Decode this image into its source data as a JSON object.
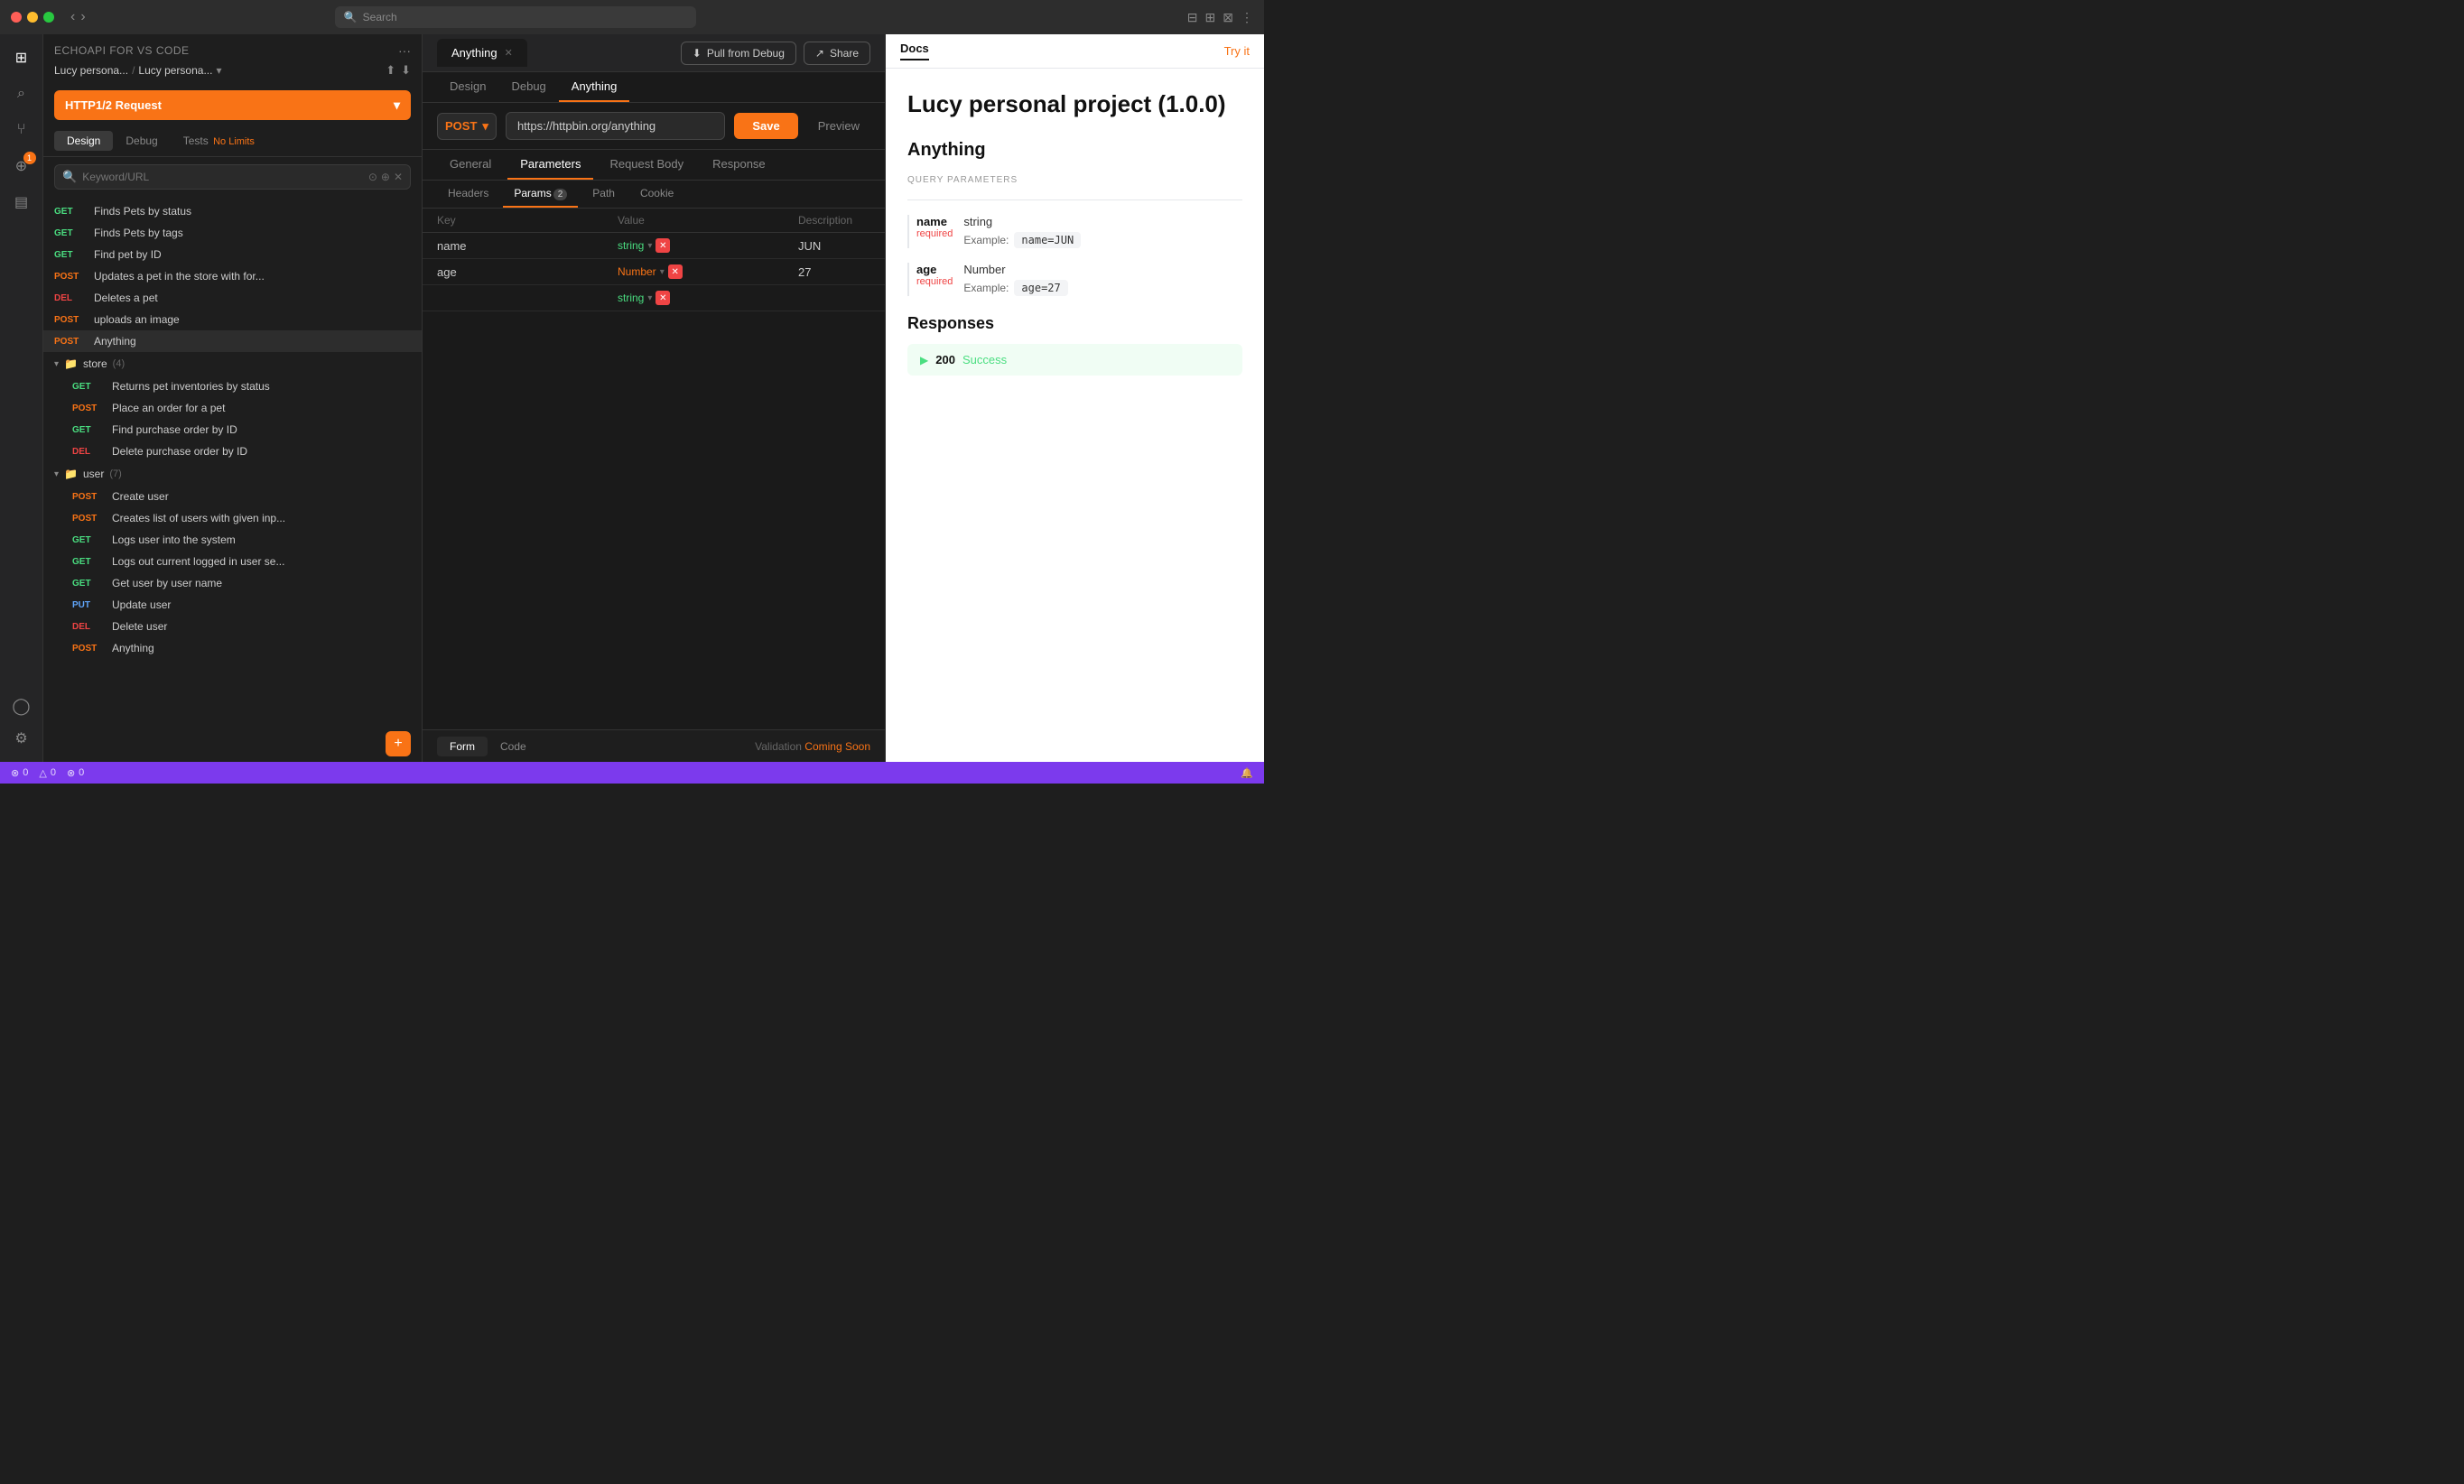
{
  "titlebar": {
    "search_placeholder": "Search",
    "icons": [
      "sidebar-icon",
      "layout-icon",
      "split-icon",
      "grid-icon"
    ]
  },
  "icon_sidebar": {
    "items": [
      {
        "name": "layers-icon",
        "symbol": "⊞",
        "active": true
      },
      {
        "name": "search-icon",
        "symbol": "⌕"
      },
      {
        "name": "git-icon",
        "symbol": "⑂"
      },
      {
        "name": "extension-icon",
        "symbol": "⊕",
        "badge": "1"
      },
      {
        "name": "collection-icon",
        "symbol": "▤"
      },
      {
        "name": "user-icon",
        "symbol": "○"
      },
      {
        "name": "settings-icon",
        "symbol": "⚙"
      }
    ]
  },
  "tree_panel": {
    "title": "ECHOAPI FOR VS CODE",
    "breadcrumb1": "Lucy persona...",
    "breadcrumb2": "Lucy persona...",
    "request_btn_label": "HTTP1/2 Request",
    "design_tab": "Design",
    "debug_tab": "Debug",
    "tests_tab": "Tests",
    "no_limits": "No Limits",
    "search_placeholder": "Keyword/URL",
    "tree_items": [
      {
        "type": "item",
        "method": "GET",
        "label": "Finds Pets by status",
        "method_class": "method-get"
      },
      {
        "type": "item",
        "method": "GET",
        "label": "Finds Pets by tags",
        "method_class": "method-get"
      },
      {
        "type": "item",
        "method": "GET",
        "label": "Find pet by ID",
        "method_class": "method-get"
      },
      {
        "type": "item",
        "method": "POST",
        "label": "Updates a pet in the store with for...",
        "method_class": "method-post"
      },
      {
        "type": "item",
        "method": "DEL",
        "label": "Deletes a pet",
        "method_class": "method-del"
      },
      {
        "type": "item",
        "method": "POST",
        "label": "uploads an image",
        "method_class": "method-post"
      },
      {
        "type": "item",
        "method": "POST",
        "label": "Anything",
        "method_class": "method-post",
        "active": true
      },
      {
        "type": "group",
        "icon": "folder",
        "label": "store",
        "count": "(4)"
      },
      {
        "type": "item",
        "method": "GET",
        "label": "Returns pet inventories by status",
        "method_class": "method-get",
        "indent": true
      },
      {
        "type": "item",
        "method": "POST",
        "label": "Place an order for a pet",
        "method_class": "method-post",
        "indent": true
      },
      {
        "type": "item",
        "method": "GET",
        "label": "Find purchase order by ID",
        "method_class": "method-get",
        "indent": true
      },
      {
        "type": "item",
        "method": "DEL",
        "label": "Delete purchase order by ID",
        "method_class": "method-del",
        "indent": true
      },
      {
        "type": "group",
        "icon": "folder",
        "label": "user",
        "count": "(7)"
      },
      {
        "type": "item",
        "method": "POST",
        "label": "Create user",
        "method_class": "method-post",
        "indent": true
      },
      {
        "type": "item",
        "method": "POST",
        "label": "Creates list of users with given inp...",
        "method_class": "method-post",
        "indent": true
      },
      {
        "type": "item",
        "method": "GET",
        "label": "Logs user into the system",
        "method_class": "method-get",
        "indent": true
      },
      {
        "type": "item",
        "method": "GET",
        "label": "Logs out current logged in user se...",
        "method_class": "method-get",
        "indent": true
      },
      {
        "type": "item",
        "method": "GET",
        "label": "Get user by user name",
        "method_class": "method-get",
        "indent": true
      },
      {
        "type": "item",
        "method": "PUT",
        "label": "Update user",
        "method_class": "method-put",
        "indent": true
      },
      {
        "type": "item",
        "method": "DEL",
        "label": "Delete user",
        "method_class": "method-del",
        "indent": true
      },
      {
        "type": "item",
        "method": "POST",
        "label": "Anything",
        "method_class": "method-post",
        "indent": true
      }
    ]
  },
  "main": {
    "tab_label": "Anything",
    "design_tab": "Design",
    "debug_tab": "Debug",
    "anything_tab": "Anything",
    "pull_debug_btn": "Pull from Debug",
    "share_btn": "Share",
    "method": "POST",
    "url": "https://httpbin.org/anything",
    "save_btn": "Save",
    "preview_btn": "Preview",
    "req_tabs": [
      "General",
      "Parameters",
      "Request Body",
      "Response"
    ],
    "params_sub_tabs": [
      "Headers",
      "Params",
      "Path",
      "Cookie"
    ],
    "params_badge": "2",
    "params_table": {
      "headers": [
        "Key",
        "Value",
        "Description"
      ],
      "rows": [
        {
          "key": "name",
          "type": "string",
          "type_class": "type-string",
          "value": "JUN",
          "description": ""
        },
        {
          "key": "age",
          "type": "Number",
          "type_class": "type-number",
          "value": "27",
          "description": ""
        },
        {
          "key": "",
          "type": "string",
          "type_class": "type-string",
          "value": "",
          "description": ""
        }
      ]
    },
    "form_tab": "Form",
    "code_tab": "Code",
    "validation_label": "Validation",
    "coming_soon": "Coming Soon"
  },
  "docs": {
    "tab_label": "Docs",
    "try_it_label": "Try it",
    "project_title": "Lucy personal project (1.0.0)",
    "section_title": "Anything",
    "query_params_label": "QUERY PARAMETERS",
    "params": [
      {
        "name": "name",
        "required": "required",
        "type": "string",
        "example_label": "Example:",
        "example_value": "name=JUN"
      },
      {
        "name": "age",
        "required": "required",
        "type": "Number",
        "example_label": "Example:",
        "example_value": "age=27"
      }
    ],
    "responses_title": "Responses",
    "responses": [
      {
        "code": "200",
        "message": "Success"
      }
    ]
  },
  "status_bar": {
    "item1": "⊘ 0",
    "item2": "△ 0",
    "item3": "⊘ 0",
    "bell": "🔔"
  }
}
